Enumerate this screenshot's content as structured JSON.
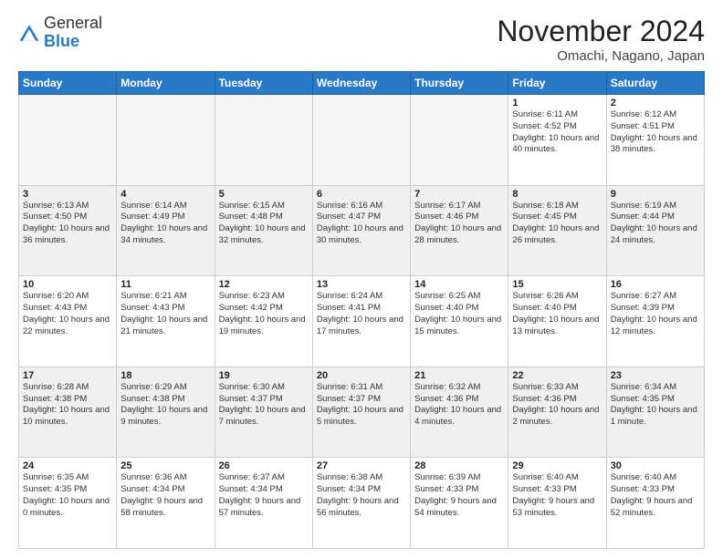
{
  "header": {
    "logo_general": "General",
    "logo_blue": "Blue",
    "month": "November 2024",
    "location": "Omachi, Nagano, Japan"
  },
  "days_of_week": [
    "Sunday",
    "Monday",
    "Tuesday",
    "Wednesday",
    "Thursday",
    "Friday",
    "Saturday"
  ],
  "weeks": [
    [
      {
        "day": "",
        "empty": true
      },
      {
        "day": "",
        "empty": true
      },
      {
        "day": "",
        "empty": true
      },
      {
        "day": "",
        "empty": true
      },
      {
        "day": "",
        "empty": true
      },
      {
        "day": "1",
        "sunrise": "Sunrise: 6:11 AM",
        "sunset": "Sunset: 4:52 PM",
        "daylight": "Daylight: 10 hours and 40 minutes."
      },
      {
        "day": "2",
        "sunrise": "Sunrise: 6:12 AM",
        "sunset": "Sunset: 4:51 PM",
        "daylight": "Daylight: 10 hours and 38 minutes."
      }
    ],
    [
      {
        "day": "3",
        "sunrise": "Sunrise: 6:13 AM",
        "sunset": "Sunset: 4:50 PM",
        "daylight": "Daylight: 10 hours and 36 minutes."
      },
      {
        "day": "4",
        "sunrise": "Sunrise: 6:14 AM",
        "sunset": "Sunset: 4:49 PM",
        "daylight": "Daylight: 10 hours and 34 minutes."
      },
      {
        "day": "5",
        "sunrise": "Sunrise: 6:15 AM",
        "sunset": "Sunset: 4:48 PM",
        "daylight": "Daylight: 10 hours and 32 minutes."
      },
      {
        "day": "6",
        "sunrise": "Sunrise: 6:16 AM",
        "sunset": "Sunset: 4:47 PM",
        "daylight": "Daylight: 10 hours and 30 minutes."
      },
      {
        "day": "7",
        "sunrise": "Sunrise: 6:17 AM",
        "sunset": "Sunset: 4:46 PM",
        "daylight": "Daylight: 10 hours and 28 minutes."
      },
      {
        "day": "8",
        "sunrise": "Sunrise: 6:18 AM",
        "sunset": "Sunset: 4:45 PM",
        "daylight": "Daylight: 10 hours and 26 minutes."
      },
      {
        "day": "9",
        "sunrise": "Sunrise: 6:19 AM",
        "sunset": "Sunset: 4:44 PM",
        "daylight": "Daylight: 10 hours and 24 minutes."
      }
    ],
    [
      {
        "day": "10",
        "sunrise": "Sunrise: 6:20 AM",
        "sunset": "Sunset: 4:43 PM",
        "daylight": "Daylight: 10 hours and 22 minutes."
      },
      {
        "day": "11",
        "sunrise": "Sunrise: 6:21 AM",
        "sunset": "Sunset: 4:43 PM",
        "daylight": "Daylight: 10 hours and 21 minutes."
      },
      {
        "day": "12",
        "sunrise": "Sunrise: 6:23 AM",
        "sunset": "Sunset: 4:42 PM",
        "daylight": "Daylight: 10 hours and 19 minutes."
      },
      {
        "day": "13",
        "sunrise": "Sunrise: 6:24 AM",
        "sunset": "Sunset: 4:41 PM",
        "daylight": "Daylight: 10 hours and 17 minutes."
      },
      {
        "day": "14",
        "sunrise": "Sunrise: 6:25 AM",
        "sunset": "Sunset: 4:40 PM",
        "daylight": "Daylight: 10 hours and 15 minutes."
      },
      {
        "day": "15",
        "sunrise": "Sunrise: 6:26 AM",
        "sunset": "Sunset: 4:40 PM",
        "daylight": "Daylight: 10 hours and 13 minutes."
      },
      {
        "day": "16",
        "sunrise": "Sunrise: 6:27 AM",
        "sunset": "Sunset: 4:39 PM",
        "daylight": "Daylight: 10 hours and 12 minutes."
      }
    ],
    [
      {
        "day": "17",
        "sunrise": "Sunrise: 6:28 AM",
        "sunset": "Sunset: 4:38 PM",
        "daylight": "Daylight: 10 hours and 10 minutes."
      },
      {
        "day": "18",
        "sunrise": "Sunrise: 6:29 AM",
        "sunset": "Sunset: 4:38 PM",
        "daylight": "Daylight: 10 hours and 9 minutes."
      },
      {
        "day": "19",
        "sunrise": "Sunrise: 6:30 AM",
        "sunset": "Sunset: 4:37 PM",
        "daylight": "Daylight: 10 hours and 7 minutes."
      },
      {
        "day": "20",
        "sunrise": "Sunrise: 6:31 AM",
        "sunset": "Sunset: 4:37 PM",
        "daylight": "Daylight: 10 hours and 5 minutes."
      },
      {
        "day": "21",
        "sunrise": "Sunrise: 6:32 AM",
        "sunset": "Sunset: 4:36 PM",
        "daylight": "Daylight: 10 hours and 4 minutes."
      },
      {
        "day": "22",
        "sunrise": "Sunrise: 6:33 AM",
        "sunset": "Sunset: 4:36 PM",
        "daylight": "Daylight: 10 hours and 2 minutes."
      },
      {
        "day": "23",
        "sunrise": "Sunrise: 6:34 AM",
        "sunset": "Sunset: 4:35 PM",
        "daylight": "Daylight: 10 hours and 1 minute."
      }
    ],
    [
      {
        "day": "24",
        "sunrise": "Sunrise: 6:35 AM",
        "sunset": "Sunset: 4:35 PM",
        "daylight": "Daylight: 10 hours and 0 minutes."
      },
      {
        "day": "25",
        "sunrise": "Sunrise: 6:36 AM",
        "sunset": "Sunset: 4:34 PM",
        "daylight": "Daylight: 9 hours and 58 minutes."
      },
      {
        "day": "26",
        "sunrise": "Sunrise: 6:37 AM",
        "sunset": "Sunset: 4:34 PM",
        "daylight": "Daylight: 9 hours and 57 minutes."
      },
      {
        "day": "27",
        "sunrise": "Sunrise: 6:38 AM",
        "sunset": "Sunset: 4:34 PM",
        "daylight": "Daylight: 9 hours and 56 minutes."
      },
      {
        "day": "28",
        "sunrise": "Sunrise: 6:39 AM",
        "sunset": "Sunset: 4:33 PM",
        "daylight": "Daylight: 9 hours and 54 minutes."
      },
      {
        "day": "29",
        "sunrise": "Sunrise: 6:40 AM",
        "sunset": "Sunset: 4:33 PM",
        "daylight": "Daylight: 9 hours and 53 minutes."
      },
      {
        "day": "30",
        "sunrise": "Sunrise: 6:40 AM",
        "sunset": "Sunset: 4:33 PM",
        "daylight": "Daylight: 9 hours and 52 minutes."
      }
    ]
  ]
}
